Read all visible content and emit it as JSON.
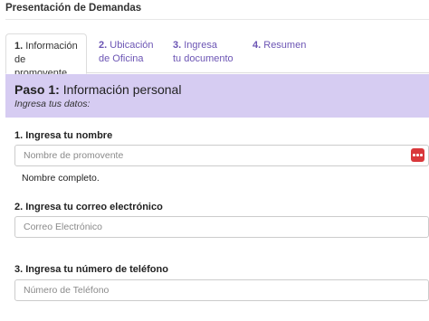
{
  "page": {
    "title": "Presentación de Demandas"
  },
  "tabs": [
    {
      "num": "1.",
      "line1": " Información",
      "line2": "de promovente"
    },
    {
      "num": "2.",
      "line1": " Ubicación",
      "line2": "de Oficina"
    },
    {
      "num": "3.",
      "line1": " Ingresa",
      "line2": "tu documento"
    },
    {
      "num": "4.",
      "line1": " Resumen",
      "line2": ""
    }
  ],
  "step": {
    "label": "Paso 1:",
    "title": " Información personal",
    "subtitle": "Ingresa tus datos:"
  },
  "fields": {
    "name": {
      "label": "1. Ingresa tu nombre",
      "placeholder": "Nombre de promovente",
      "value": "",
      "help": "Nombre completo."
    },
    "email": {
      "label": "2. Ingresa tu correo electrónico",
      "placeholder": "Correo Electrónico",
      "value": ""
    },
    "phone": {
      "label": "3. Ingresa tu número de teléfono",
      "placeholder": "Número de Teléfono",
      "value": ""
    }
  },
  "colors": {
    "accent": "#6c55b4",
    "step_bg": "#d6ccf2",
    "icon_red": "#d9383b"
  },
  "icons": {
    "name_field_addon": "more-dots-icon"
  }
}
